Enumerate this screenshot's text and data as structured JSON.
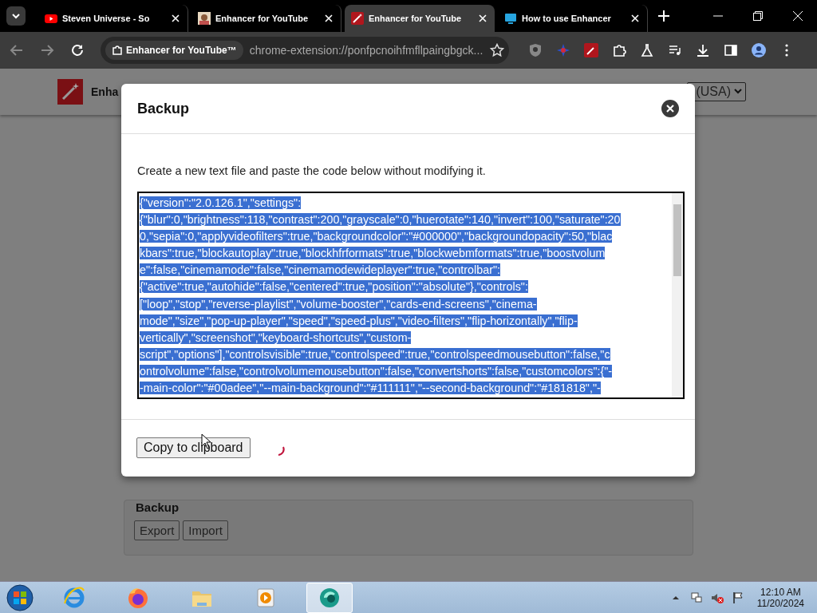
{
  "browser": {
    "tabs": [
      {
        "title": "Steven Universe - So",
        "kind": "youtube",
        "selected": false
      },
      {
        "title": "Enhancer for YouTube",
        "kind": "photo",
        "selected": false
      },
      {
        "title": "Enhancer for YouTube",
        "kind": "enhancer",
        "selected": true
      },
      {
        "title": "How to use Enhancer",
        "kind": "monitor",
        "selected": false
      }
    ],
    "site_chip": "Enhancer for YouTube™",
    "url": "chrome-extension://ponfpcnoihfmfllpaingbgck..."
  },
  "page": {
    "header_title": "Enha",
    "select_value": "(USA)",
    "section": {
      "legend": "Backup",
      "buttons": [
        "Export",
        "Import"
      ]
    }
  },
  "modal": {
    "title": "Backup",
    "description": "Create a new text file and paste the code below without modifying it.",
    "code_lines": [
      "{\"version\":\"2.0.126.1\",\"settings\":",
      "{\"blur\":0,\"brightness\":118,\"contrast\":200,\"grayscale\":0,\"huerotate\":140,\"invert\":100,\"saturate\":20",
      "0,\"sepia\":0,\"applyvideofilters\":true,\"backgroundcolor\":\"#000000\",\"backgroundopacity\":50,\"blac",
      "kbars\":true,\"blockautoplay\":true,\"blockhfrformats\":true,\"blockwebmformats\":true,\"boostvolum",
      "e\":false,\"cinemamode\":false,\"cinemamodewideplayer\":true,\"controlbar\":",
      "{\"active\":true,\"autohide\":false,\"centered\":true,\"position\":\"absolute\"},\"controls\":",
      "[\"loop\",\"stop\",\"reverse-playlist\",\"volume-booster\",\"cards-end-screens\",\"cinema-",
      "mode\",\"size\",\"pop-up-player\",\"speed\",\"speed-plus\",\"video-filters\",\"flip-horizontally\",\"flip-",
      "vertically\",\"screenshot\",\"keyboard-shortcuts\",\"custom-",
      "script\",\"options\"],\"controlsvisible\":true,\"controlspeed\":true,\"controlspeedmousebutton\":false,\"c",
      "ontrolvolume\":false,\"controlvolumemousebutton\":false,\"convertshorts\":false,\"customcolors\":{\"-",
      "-main-color\":\"#00adee\",\"--main-background\":\"#111111\",\"--second-background\":\"#181818\",\"-"
    ],
    "button": "Copy to clipboard"
  },
  "taskbar": {
    "apps": [
      {
        "kind": "ie",
        "selected": false
      },
      {
        "kind": "firefox",
        "selected": false
      },
      {
        "kind": "folder",
        "selected": false
      },
      {
        "kind": "media",
        "selected": false
      },
      {
        "kind": "app",
        "selected": true
      }
    ],
    "time": "12:10 AM",
    "date": "11/20/2024"
  }
}
